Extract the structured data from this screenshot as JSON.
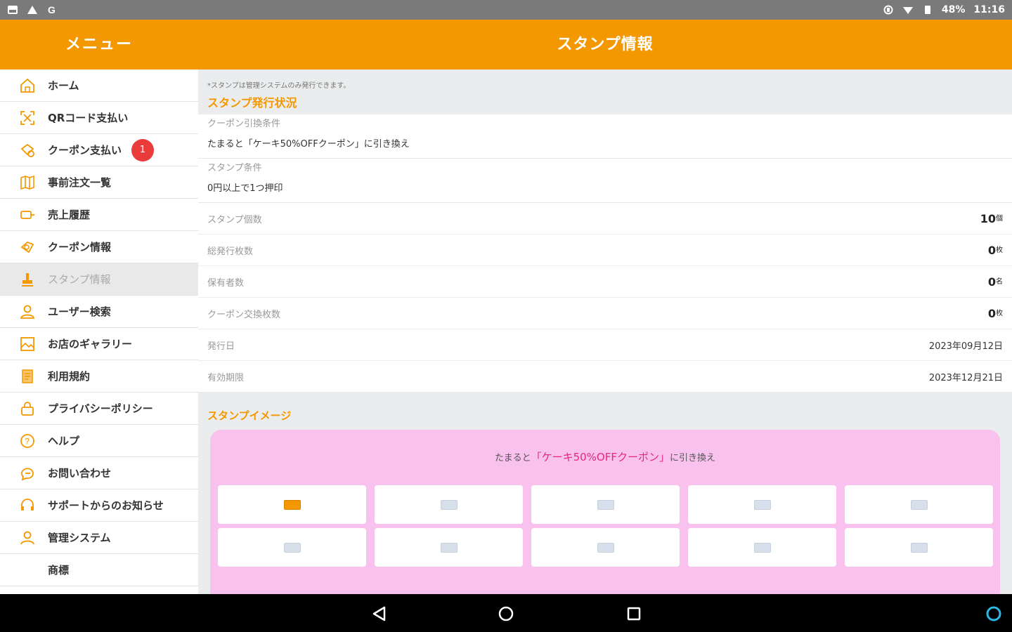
{
  "status_bar": {
    "left_icons": [
      "image-icon",
      "warning-icon",
      "google-icon"
    ],
    "right_icons": [
      "cast-icon",
      "wifi-icon",
      "battery-icon"
    ],
    "battery": "48%",
    "time": "11:16"
  },
  "header": {
    "menu_title": "メニュー",
    "page_title": "スタンプ情報"
  },
  "sidebar": {
    "items": [
      {
        "label": "ホーム",
        "icon": "home-icon"
      },
      {
        "label": "QRコード支払い",
        "icon": "qr-code-icon"
      },
      {
        "label": "クーポン支払い",
        "icon": "coupon-pay-icon",
        "badge": "1"
      },
      {
        "label": "事前注文一覧",
        "icon": "map-icon"
      },
      {
        "label": "売上履歴",
        "icon": "sales-icon"
      },
      {
        "label": "クーポン情報",
        "icon": "coupon-icon"
      },
      {
        "label": "スタンプ情報",
        "icon": "stamp-icon",
        "active": true
      },
      {
        "label": "ユーザー検索",
        "icon": "user-search-icon"
      },
      {
        "label": "お店のギャラリー",
        "icon": "gallery-icon"
      },
      {
        "label": "利用規約",
        "icon": "terms-icon"
      },
      {
        "label": "プライバシーポリシー",
        "icon": "lock-icon"
      },
      {
        "label": "ヘルプ",
        "icon": "help-icon"
      },
      {
        "label": "お問い合わせ",
        "icon": "chat-icon"
      },
      {
        "label": "サポートからのお知らせ",
        "icon": "headset-icon"
      },
      {
        "label": "管理システム",
        "icon": "person-icon"
      },
      {
        "label": "商標",
        "icon": ""
      }
    ]
  },
  "main": {
    "note": "*スタンプは管理システムのみ発行できます。",
    "issue_section_title": "スタンプ発行状況",
    "coupon_condition_label": "クーポン引換条件",
    "coupon_condition_value": "たまると「ケーキ50%OFFクーポン」に引き換え",
    "stamp_condition_label": "スタンプ条件",
    "stamp_condition_value": "0円以上で1つ押印",
    "rows": [
      {
        "label": "スタンプ個数",
        "value": "10",
        "unit": "個"
      },
      {
        "label": "総発行枚数",
        "value": "0",
        "unit": "枚"
      },
      {
        "label": "保有者数",
        "value": "0",
        "unit": "名"
      },
      {
        "label": "クーポン交換枚数",
        "value": "0",
        "unit": "枚"
      }
    ],
    "issue_date_label": "発行日",
    "issue_date_value": "2023年09月12日",
    "expiry_label": "有効期限",
    "expiry_value": "2023年12月21日",
    "image_section_title": "スタンプイメージ",
    "stamp_card": {
      "caption_prefix": "たまると",
      "caption_highlight": "「ケーキ50%OFFクーポン」",
      "caption_suffix": "に引き換え",
      "total": 10,
      "filled": 1,
      "filled_color": "#f39800",
      "card_color": "#f9c2ee"
    }
  },
  "colors": {
    "accent": "#f39800",
    "badge": "#ea3b3b",
    "highlight": "#e2287a"
  }
}
